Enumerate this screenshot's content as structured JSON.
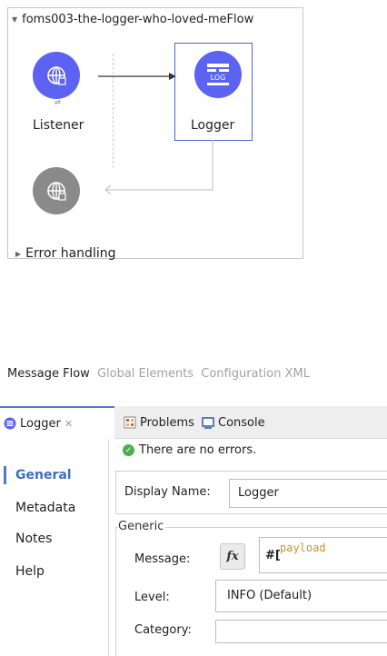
{
  "flow": {
    "title": "foms003-the-logger-who-loved-meFlow",
    "listener_label": "Listener",
    "logger_label": "Logger",
    "logger_icon_text": "LOG",
    "error_handling_label": "Error handling"
  },
  "view_tabs": {
    "message_flow": "Message Flow",
    "global_elements": "Global Elements",
    "configuration_xml": "Configuration XML"
  },
  "editor_tabs": {
    "logger": "Logger",
    "problems": "Problems",
    "console": "Console"
  },
  "side_nav": {
    "items": [
      "General",
      "Metadata",
      "Notes",
      "Help"
    ],
    "active": "General"
  },
  "properties": {
    "status": "There are no errors.",
    "display_name_label": "Display Name:",
    "display_name_value": "Logger",
    "generic_legend": "Generic",
    "message_label": "Message:",
    "fx_label": "fx",
    "message_prefix": "#[",
    "message_expression": "payload",
    "level_label": "Level:",
    "level_value": "INFO (Default)",
    "category_label": "Category:",
    "category_value": ""
  },
  "colors": {
    "accent_blue": "#5b63f0",
    "error_grey": "#8a8a8a",
    "selection_border": "#4a64d8",
    "nav_active": "#3a6fc4",
    "success_green": "#4caf50",
    "expression_gold": "#c8962a"
  },
  "icons": {
    "listener": "globe-icon",
    "logger": "log-icon",
    "error_source": "globe-icon",
    "status": "check-circle-icon"
  }
}
